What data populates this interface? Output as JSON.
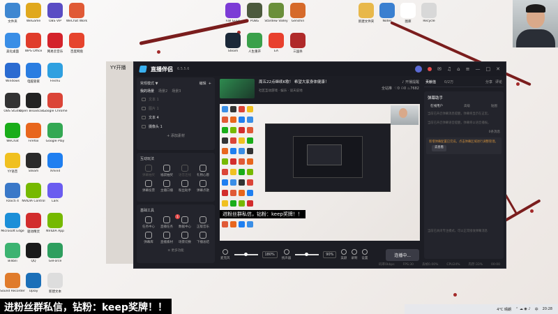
{
  "desktop": {
    "icons_col1": [
      {
        "label": "文件夹",
        "color": "#3f87d1"
      },
      {
        "label": "美化桌面",
        "color": "#3a8ee6"
      },
      {
        "label": "Windows",
        "color": "#2b6bd1"
      },
      {
        "label": "OBS Studio",
        "color": "#333333"
      },
      {
        "label": "WeChat",
        "color": "#1aad19"
      },
      {
        "label": "YY语音",
        "color": "#f0c020"
      },
      {
        "label": "Rzocti 4",
        "color": "#3a78c8"
      },
      {
        "label": "Microsoft Edge",
        "color": "#1c8fd8"
      },
      {
        "label": "Bilibili",
        "color": "#3cb371"
      },
      {
        "label": "Sound Recorder",
        "color": "#e07b2b"
      }
    ],
    "icons_col2": [
      {
        "label": "WeGame",
        "color": "#e0a81e"
      },
      {
        "label": "WPS Office",
        "color": "#e03c2b"
      },
      {
        "label": "电脑管家",
        "color": "#2a7de1"
      },
      {
        "label": "Open Broadcaster",
        "color": "#222222"
      },
      {
        "label": "Firefox",
        "color": "#e8661d"
      },
      {
        "label": "Steam",
        "color": "#2a2a2a"
      },
      {
        "label": "NVIDIA Control",
        "color": "#76b900"
      },
      {
        "label": "驱动精灵",
        "color": "#d22d2d"
      },
      {
        "label": "QQ",
        "color": "#1a1a1a"
      },
      {
        "label": "Uplay",
        "color": "#1b6fb8"
      }
    ],
    "icons_col3": [
      {
        "label": "OBS VIP",
        "color": "#5a4cc4"
      },
      {
        "label": "网易云音乐",
        "color": "#d4232b"
      },
      {
        "label": "Feishu",
        "color": "#2fa0e0"
      },
      {
        "label": "Google Chrome",
        "color": "#db4437"
      },
      {
        "label": "Google Play",
        "color": "#34a853"
      },
      {
        "label": "Xmind",
        "color": "#1f7ff0"
      },
      {
        "label": "Lark",
        "color": "#6a5cf0"
      },
      {
        "label": "NVIDIA App",
        "color": "#76b900"
      },
      {
        "label": "GeForce",
        "color": "#2e9e5e"
      },
      {
        "label": "新建文本",
        "color": "#dddddd"
      }
    ],
    "icons_col4": [
      {
        "label": "WeChat Work",
        "color": "#e05a36"
      },
      {
        "label": "百度网盘",
        "color": "#e6442d"
      }
    ],
    "icons_top": [
      {
        "label": "Fall Guys",
        "color": "#7c3bd6"
      },
      {
        "label": "PUBG",
        "color": "#4c5a3d"
      },
      {
        "label": "Stardew Valley",
        "color": "#6a8f3a"
      },
      {
        "label": "Genshin",
        "color": "#d66a2a"
      },
      {
        "label": "Steam",
        "color": "#1b2838"
      },
      {
        "label": "人生重开",
        "color": "#3aa04a"
      },
      {
        "label": "EA",
        "color": "#e8402d"
      },
      {
        "label": "三国杀",
        "color": "#b02a2a"
      }
    ],
    "icons_topright": [
      {
        "label": "新建文件夹",
        "color": "#e8b84a"
      },
      {
        "label": "Notes",
        "color": "#3a7fd0"
      },
      {
        "label": "图库",
        "color": "#ffffff"
      },
      {
        "label": "Recycle",
        "color": "#d8d8d8"
      }
    ]
  },
  "ghost_window": {
    "title": "YY开播"
  },
  "app": {
    "name": "直播伴侣",
    "version": "6.5.5.6",
    "scene_section": {
      "title": "常规模式 ▼",
      "action_edit": "编辑",
      "action_add": "+",
      "tabs": [
        "我的场景",
        "场景2",
        "场景3"
      ],
      "sources": [
        {
          "label": "文本 1",
          "on": false
        },
        {
          "label": "图片 1",
          "on": false
        },
        {
          "label": "文本 4",
          "on": true
        },
        {
          "label": "摄像头 1",
          "on": true
        }
      ],
      "add_label": "+ 添加素材"
    },
    "interact_section": {
      "title": "互动玩法",
      "items": [
        {
          "label": "弹幕抽奖",
          "dim": true
        },
        {
          "label": "福袋抽奖",
          "dim": false
        },
        {
          "label": "语音连线",
          "dim": true
        },
        {
          "label": "礼物心愿",
          "dim": false
        },
        {
          "label": "弹幕投票",
          "dim": false
        },
        {
          "label": "主播口播",
          "dim": false
        },
        {
          "label": "粉丝助手",
          "dim": false
        },
        {
          "label": "弹幕点歌",
          "dim": false
        }
      ]
    },
    "tools_section": {
      "title": "基础工具",
      "items": [
        {
          "label": "任务中心",
          "badge": ""
        },
        {
          "label": "直播任务",
          "badge": "1"
        },
        {
          "label": "数据中心",
          "badge": ""
        },
        {
          "label": "正版音乐",
          "badge": ""
        },
        {
          "label": "弹幕库",
          "badge": ""
        },
        {
          "label": "直播素材",
          "badge": ""
        },
        {
          "label": "场景切换",
          "badge": ""
        },
        {
          "label": "下播总结",
          "badge": ""
        }
      ],
      "more": "更多功能"
    },
    "room": {
      "title": "周五22点继续K歌！ 希望大家身体健康！",
      "subtitle": "社区互动游戏 · 娱乐 · 谈天说地",
      "stat_notice": "开播提醒",
      "stat_all": "全站推",
      "stat_likes": "0",
      "stat_viewers": "0",
      "stat_hot": "7682"
    },
    "preview_overlay": "进粉丝群私信，钻粉：keep奖牌！！",
    "controls": {
      "mic_label": "麦克风",
      "mic_pct": "180%",
      "speaker_label": "扬声器",
      "speaker_pct": "90%",
      "beauty_label": "美颜",
      "record_label": "录制",
      "settings_label": "设置",
      "start_label": "连播中..."
    },
    "status": {
      "bitrate": "码率0kbps",
      "fps": "FPS:30",
      "drop": "丢帧0.00%",
      "cpu": "CPU24%",
      "mem": "内存:33%",
      "time": "00:00"
    },
    "right": {
      "tabs": [
        "贡献值",
        "0/2万"
      ],
      "tools": [
        "分享",
        "评论"
      ],
      "section_title": "弹幕助手",
      "subtabs": [
        "在线用户",
        "高级",
        "贴图"
      ],
      "tip1": "当前已开启弹幕消息提醒，弹幕将显示在这里。",
      "tip2": "当前已开启弹幕语音提醒，弹幕将以语音播报。",
      "warn": "新增弹幕配置已完成，点击弹幕区域进行调整管理。",
      "warn_btn": "去查看",
      "count": "0条消息",
      "footer": "当前已关闭专注模式，可以正常接收弹幕消息"
    }
  },
  "taskbar": {
    "weather": "4°C 晴朗",
    "time": "20:28",
    "lang": "中"
  },
  "caption": "进粉丝群私信，钻粉：keep奖牌！！"
}
